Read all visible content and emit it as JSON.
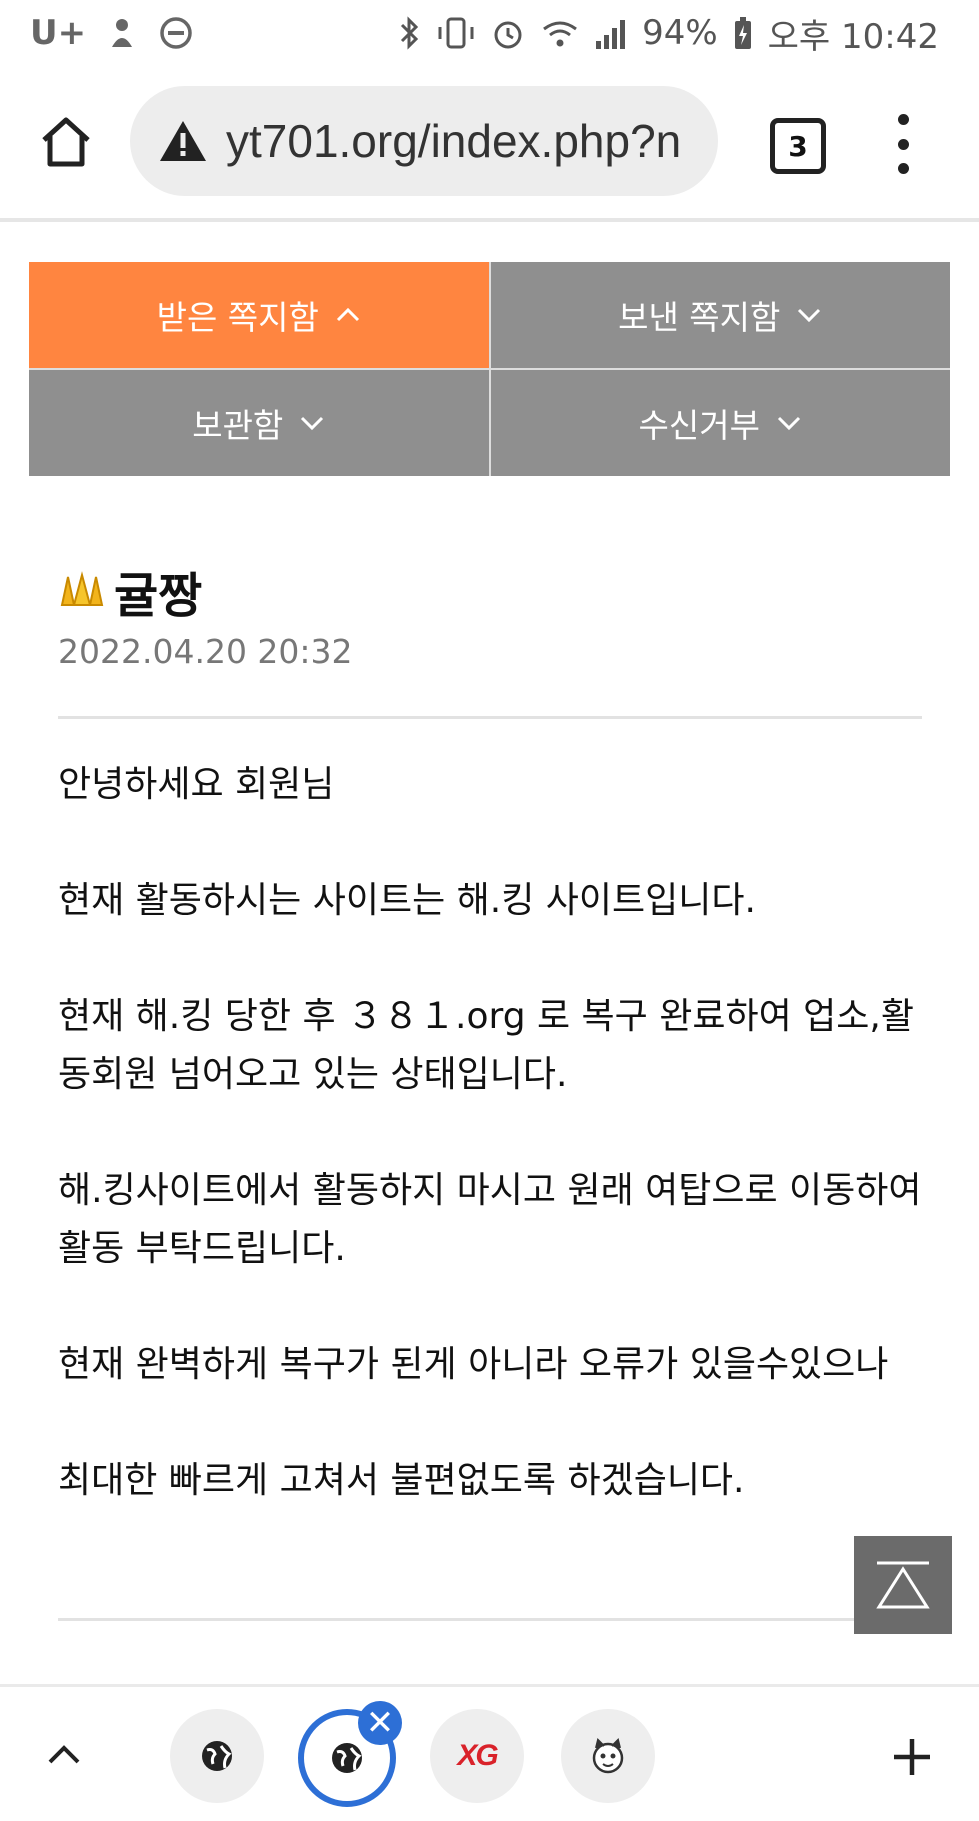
{
  "status_bar": {
    "carrier": "U+",
    "battery": "94%",
    "time": "오후 10:42"
  },
  "browser": {
    "url": "yt701.org/index.php?n",
    "tab_count": "3"
  },
  "tabs": [
    {
      "label": "받은 쪽지함",
      "active": true
    },
    {
      "label": "보낸 쪽지함",
      "active": false
    },
    {
      "label": "보관함",
      "active": false
    },
    {
      "label": "수신거부",
      "active": false
    }
  ],
  "message": {
    "sender": "귤짱",
    "date": "2022.04.20 20:32",
    "paragraphs": [
      "안녕하세요 회원님",
      "현재 활동하시는 사이트는 해.킹 사이트입니다.",
      "현재 해.킹 당한 후 ３８１.org 로 복구 완료하여 업소,활동회원 넘어오고 있는 상태입니다.",
      "해.킹사이트에서 활동하지 마시고 원래 여탑으로 이동하여 활동 부탁드립니다.",
      "현재 완벽하게 복구가 된게 아니라 오류가 있을수있으나",
      "최대한 빠르게 고쳐서 불편없도록 하겠습니다."
    ]
  },
  "bottom_tabs": {
    "xg_logo": "XG"
  },
  "colors": {
    "active_tab": "#ff8540",
    "inactive_tab": "#8f8f8f",
    "current_tab_ring": "#2d6fd6"
  }
}
